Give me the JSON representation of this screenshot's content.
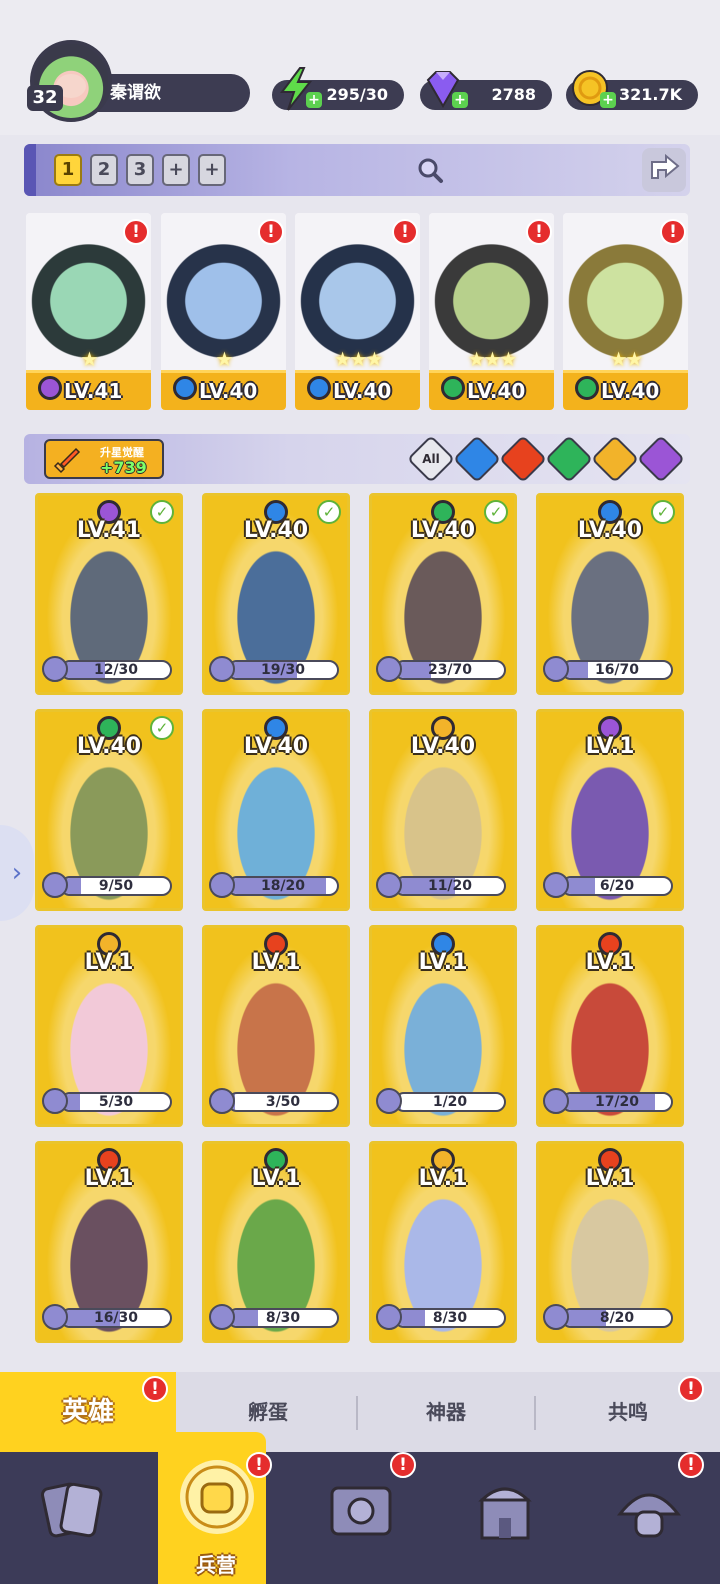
{
  "player": {
    "level": "32",
    "name": "秦谓欲"
  },
  "resources": {
    "energy": "295/30",
    "gems": "2788",
    "gold": "321.7K"
  },
  "team_tabs": [
    "1",
    "2",
    "3",
    "+",
    "+"
  ],
  "formation": [
    {
      "level": "LV.41",
      "element": "dark",
      "alert": true,
      "stars": 1
    },
    {
      "level": "LV.40",
      "element": "water",
      "alert": true,
      "stars": 1
    },
    {
      "level": "LV.40",
      "element": "water",
      "alert": true,
      "stars": 3
    },
    {
      "level": "LV.40",
      "element": "wind",
      "alert": true,
      "stars": 3
    },
    {
      "level": "LV.40",
      "element": "wind",
      "alert": true,
      "stars": 2
    }
  ],
  "awaken": {
    "title": "升星觉醒",
    "value": "+739"
  },
  "filters": [
    "All",
    "water",
    "fire",
    "wind",
    "light",
    "dark"
  ],
  "heroes": [
    {
      "level": "LV.41",
      "element": "dark",
      "progress": "12/30",
      "done": true
    },
    {
      "level": "LV.40",
      "element": "water",
      "progress": "19/30",
      "done": true
    },
    {
      "level": "LV.40",
      "element": "wind",
      "progress": "23/70",
      "done": true
    },
    {
      "level": "LV.40",
      "element": "water",
      "progress": "16/70",
      "done": true
    },
    {
      "level": "LV.40",
      "element": "wind",
      "progress": "9/50",
      "done": true
    },
    {
      "level": "LV.40",
      "element": "water",
      "progress": "18/20",
      "done": false
    },
    {
      "level": "LV.40",
      "element": "light",
      "progress": "11/20",
      "done": false
    },
    {
      "level": "LV.1",
      "element": "dark",
      "progress": "6/20",
      "done": false
    },
    {
      "level": "LV.1",
      "element": "light",
      "progress": "5/30",
      "done": false
    },
    {
      "level": "LV.1",
      "element": "fire",
      "progress": "3/50",
      "done": false
    },
    {
      "level": "LV.1",
      "element": "water",
      "progress": "1/20",
      "done": false
    },
    {
      "level": "LV.1",
      "element": "fire",
      "progress": "17/20",
      "done": false
    },
    {
      "level": "LV.1",
      "element": "fire",
      "progress": "16/30",
      "done": false
    },
    {
      "level": "LV.1",
      "element": "wind",
      "progress": "8/30",
      "done": false
    },
    {
      "level": "LV.1",
      "element": "light",
      "progress": "8/30",
      "done": false
    },
    {
      "level": "LV.1",
      "element": "fire",
      "progress": "8/20",
      "done": false
    }
  ],
  "subtabs": [
    "英雄",
    "孵蛋",
    "神器",
    "共鸣"
  ],
  "bottom_nav": {
    "active_label": "兵营"
  },
  "colors": {
    "dark": "#9b55d6",
    "water": "#2f86e6",
    "fire": "#e7421e",
    "wind": "#2eb45a",
    "light": "#f2b32a",
    "gold": "#ffd21f",
    "navy": "#3c3b58"
  }
}
